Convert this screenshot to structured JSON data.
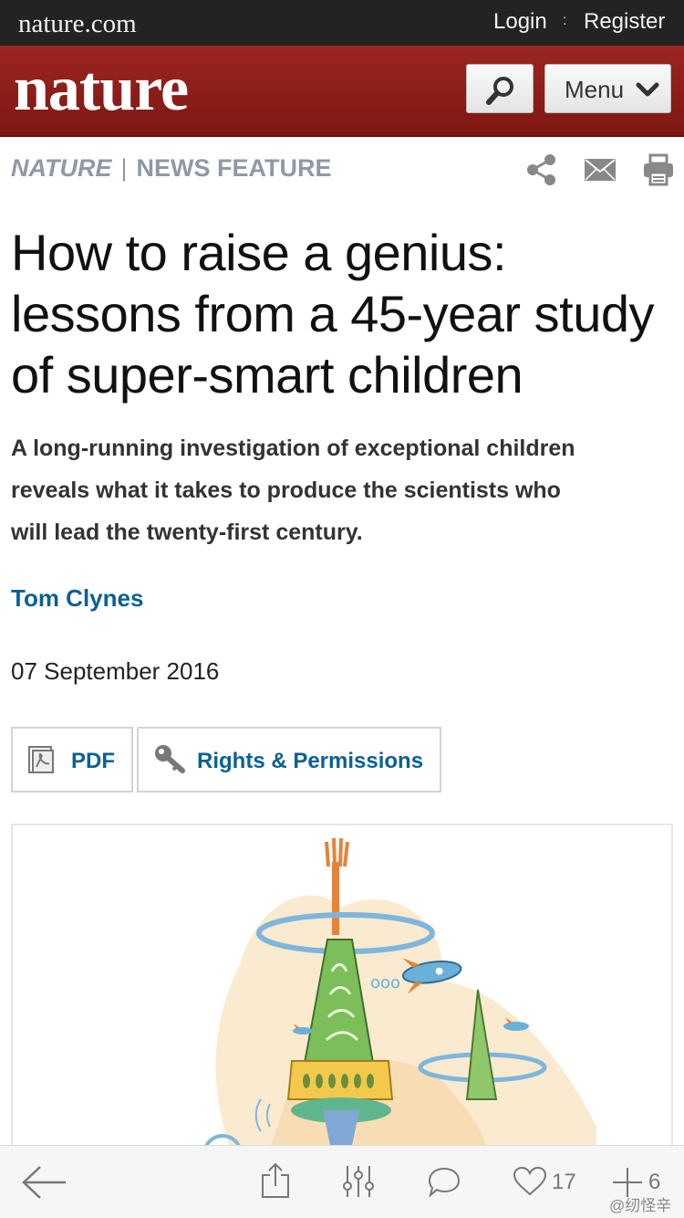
{
  "topbar": {
    "site_name": "nature.com",
    "login": "Login",
    "separator": ":",
    "register": "Register"
  },
  "header": {
    "logo_text": "nature",
    "search_icon": "magnifier-icon",
    "menu_label": "Menu",
    "brand_color": "#8f1d19"
  },
  "section": {
    "journal": "NATURE",
    "separator": "|",
    "type": "NEWS FEATURE",
    "tools": [
      "share-icon",
      "email-icon",
      "print-icon"
    ]
  },
  "article": {
    "title_lines": [
      "How to raise a genius:",
      "lessons from a 45-year study",
      "of super-smart children"
    ],
    "standfirst_lines": [
      "A long-running investigation of exceptional children",
      "reveals what it takes to produce the scientists who",
      "will lead the twenty-first century."
    ],
    "author": "Tom Clynes",
    "date": "07 September 2016",
    "link_color": "#0b6193"
  },
  "actions": {
    "pdf_label": "PDF",
    "rights_label": "Rights & Permissions"
  },
  "bottom_bar": {
    "likes": "17",
    "adds": "6",
    "icons": [
      "back-arrow-icon",
      "share-upload-icon",
      "settings-sliders-icon",
      "comment-icon",
      "heart-icon",
      "plus-icon"
    ]
  },
  "watermark": "@纫怪辛"
}
